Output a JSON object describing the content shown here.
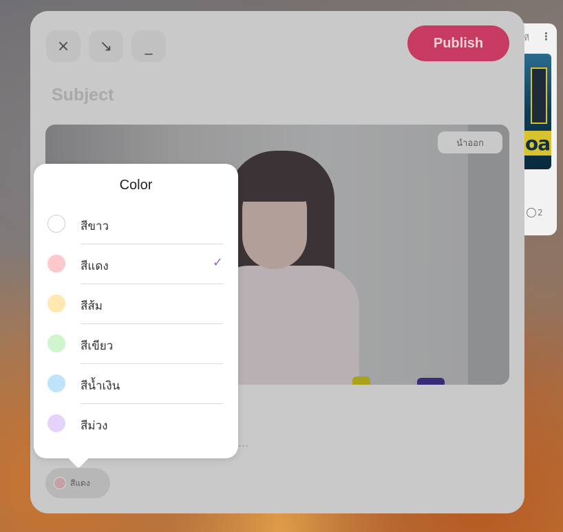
{
  "background_card": {
    "top_text": "ที",
    "thumb_text": "oar",
    "comment_count": "2"
  },
  "toolbar": {
    "close_icon": "×",
    "collapse_icon": "↘",
    "minimize_icon": "_",
    "publish_label": "Publish"
  },
  "post": {
    "subject_placeholder": "Subject",
    "remove_label": "นำออก",
    "body_placeholder": "..."
  },
  "color_picker": {
    "title": "Color",
    "options": [
      {
        "label": "สีขาว",
        "color": "#ffffff",
        "border": "#cfcfcf",
        "selected": false
      },
      {
        "label": "สีแดง",
        "color": "#ffc9cc",
        "border": "#ffc9cc",
        "selected": true
      },
      {
        "label": "สีส้ม",
        "color": "#ffe9b0",
        "border": "#ffe9b0",
        "selected": false
      },
      {
        "label": "สีเขียว",
        "color": "#cff5cf",
        "border": "#cff5cf",
        "selected": false
      },
      {
        "label": "สีน้ำเงิน",
        "color": "#bfe3fb",
        "border": "#bfe3fb",
        "selected": false
      },
      {
        "label": "สีม่วง",
        "color": "#e6d3fb",
        "border": "#e6d3fb",
        "selected": false
      }
    ],
    "check_mark": "✓"
  },
  "color_chip": {
    "label": "สีแดง"
  }
}
